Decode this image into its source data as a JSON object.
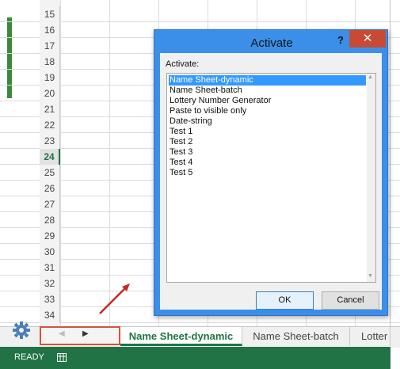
{
  "sheet": {
    "rows": [
      "15",
      "16",
      "17",
      "18",
      "19",
      "20",
      "21",
      "22",
      "23",
      "24",
      "25",
      "26",
      "27",
      "28",
      "29",
      "30",
      "31",
      "32",
      "33",
      "34"
    ],
    "active_row": "24"
  },
  "tabs": {
    "active": "Name Sheet-dynamic",
    "second": "Name Sheet-batch",
    "third": "Lotter"
  },
  "status": {
    "text": "READY"
  },
  "dialog": {
    "title": "Activate",
    "help": "?",
    "close": "✕",
    "list_label": "Activate:",
    "items": [
      "Name Sheet-dynamic",
      "Name Sheet-batch",
      "Lottery Number Generator",
      "Paste to visible only",
      "Date-string",
      "Test 1",
      "Test 2",
      "Test 3",
      "Test 4",
      "Test 5"
    ],
    "selected_item": "Name Sheet-dynamic",
    "ok_label": "OK",
    "cancel_label": "Cancel"
  },
  "colors": {
    "accent_green": "#217346",
    "dialog_blue": "#3b8fe8",
    "close_red": "#c74a35",
    "highlight_box": "#d2553b"
  },
  "icons": {
    "settings": "gear-icon",
    "nav_prev": "triangle-left-icon",
    "nav_next": "triangle-right-icon",
    "status_mode": "sheet-mode-icon",
    "annotation": "red-arrow-icon"
  }
}
